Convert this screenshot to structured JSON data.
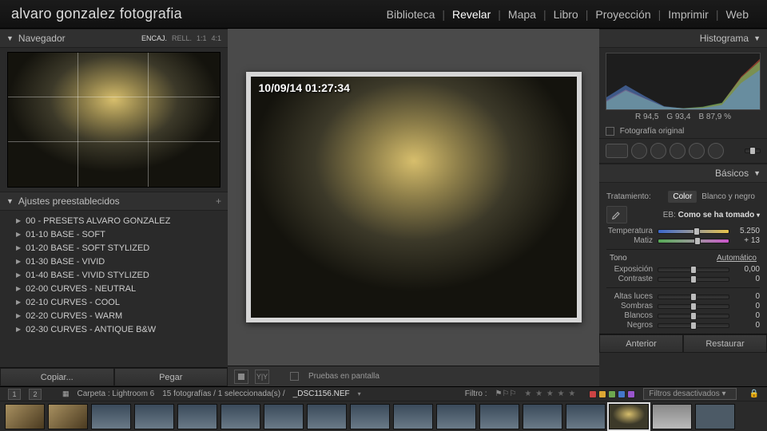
{
  "brand": "alvaro gonzalez fotografia",
  "modules": [
    "Biblioteca",
    "Revelar",
    "Mapa",
    "Libro",
    "Proyección",
    "Imprimir",
    "Web"
  ],
  "active_module": "Revelar",
  "left": {
    "navigator_title": "Navegador",
    "nav_tools": [
      "ENCAJ.",
      "RELL.",
      "1:1",
      "4:1"
    ],
    "nav_tool_selected": "ENCAJ.",
    "presets_title": "Ajustes preestablecidos",
    "presets": [
      "00 - PRESETS ALVARO GONZALEZ",
      "01-10 BASE - SOFT",
      "01-20 BASE - SOFT STYLIZED",
      "01-30 BASE - VIVID",
      "01-40 BASE - VIVID STYLIZED",
      "02-00 CURVES - NEUTRAL",
      "02-10 CURVES - COOL",
      "02-20 CURVES - WARM",
      "02-30 CURVES - ANTIQUE B&W"
    ],
    "copy_btn": "Copiar...",
    "paste_btn": "Pegar"
  },
  "center": {
    "timestamp": "10/09/14 01:27:34",
    "soft_proof_label": "Pruebas en pantalla"
  },
  "right": {
    "histogram_title": "Histograma",
    "rgb": {
      "r_label": "R",
      "r": "94,5",
      "g_label": "G",
      "g": "93,4",
      "b_label": "B",
      "b": "87,9",
      "pct": "%"
    },
    "original_label": "Fotografía original",
    "basics_title": "Básicos",
    "treatment": {
      "label": "Tratamiento:",
      "color": "Color",
      "bw": "Blanco y negro"
    },
    "wb": {
      "label_prefix": "EB:",
      "mode_label": "Como se ha tomado"
    },
    "temp": {
      "label": "Temperatura",
      "value": "5.250",
      "pos": 55
    },
    "tint": {
      "label": "Matiz",
      "value": "+ 13",
      "pos": 56
    },
    "tone_label": "Tono",
    "auto_label": "Automático",
    "sliders": [
      {
        "label": "Exposición",
        "value": "0,00",
        "pos": 50
      },
      {
        "label": "Contraste",
        "value": "0",
        "pos": 50
      },
      {
        "label": "Altas luces",
        "value": "0",
        "pos": 50
      },
      {
        "label": "Sombras",
        "value": "0",
        "pos": 50
      },
      {
        "label": "Blancos",
        "value": "0",
        "pos": 50
      },
      {
        "label": "Negros",
        "value": "0",
        "pos": 50
      }
    ],
    "before_btn": "Anterior",
    "reset_btn": "Restaurar"
  },
  "bottom": {
    "pages": [
      "1",
      "2"
    ],
    "folder_label": "Carpeta : Lightroom 6",
    "count_label": "15 fotografías / 1 seleccionada(s) /",
    "filename": "_DSC1156.NEF",
    "filter_label": "Filtro :",
    "filters_off": "Filtros desactivados",
    "chip_colors": [
      "#cc4444",
      "#dda733",
      "#6da84f",
      "#4478cc",
      "#9955cc"
    ]
  },
  "chart_data": {
    "type": "area",
    "title": "Histograma",
    "xlabel": "",
    "ylabel": "",
    "x": [
      0,
      32,
      64,
      96,
      128,
      160,
      192,
      224,
      255
    ],
    "series": [
      {
        "name": "R",
        "color": "#e05a3a",
        "values": [
          40,
          90,
          50,
          12,
          5,
          10,
          28,
          150,
          230
        ]
      },
      {
        "name": "G",
        "color": "#6fd36f",
        "values": [
          35,
          85,
          48,
          12,
          5,
          12,
          30,
          145,
          220
        ]
      },
      {
        "name": "B",
        "color": "#5a8ae0",
        "values": [
          55,
          110,
          60,
          14,
          4,
          6,
          20,
          120,
          180
        ]
      }
    ],
    "xlim": [
      0,
      255
    ],
    "ylim": [
      0,
      255
    ]
  }
}
